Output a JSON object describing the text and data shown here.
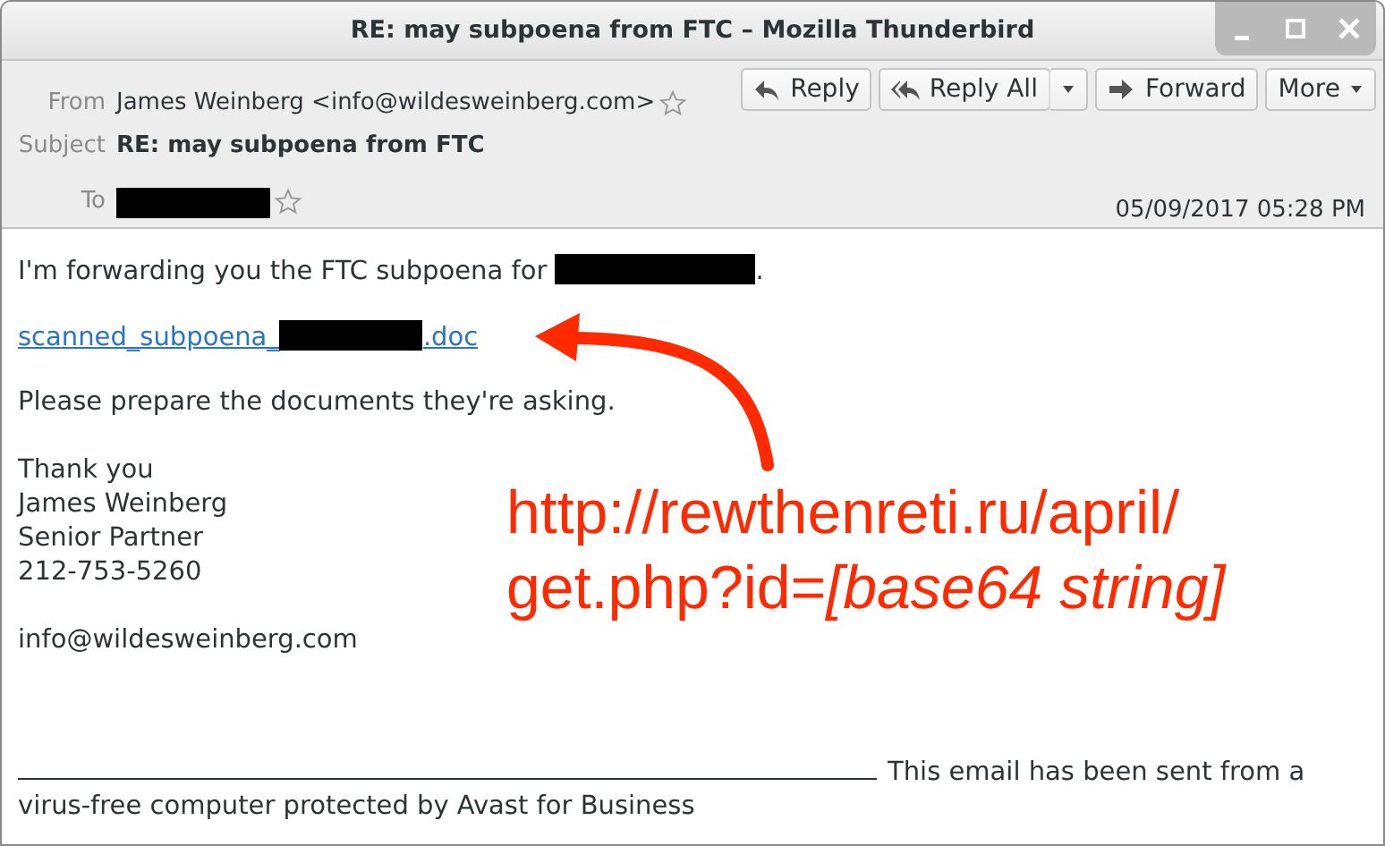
{
  "window": {
    "title": "RE: may subpoena from FTC – Mozilla Thunderbird"
  },
  "toolbar": {
    "buttons": [
      {
        "label": "Reply",
        "kind": "reply"
      },
      {
        "label": "Reply All",
        "kind": "reply-all"
      },
      {
        "label": "Forward",
        "kind": "forward"
      },
      {
        "label": "More",
        "kind": "more"
      }
    ]
  },
  "header": {
    "fields": [
      {
        "label": "From",
        "kind": "contact",
        "value": "James Weinberg <info@wildesweinberg.com>",
        "starred": false
      },
      {
        "label": "Subject",
        "kind": "subject",
        "value": "RE: may subpoena from FTC"
      },
      {
        "label": "To",
        "kind": "redacted",
        "starred": false
      }
    ],
    "date": "05/09/2017 05:28 PM"
  },
  "body": {
    "intro": {
      "text": "I'm forwarding you the FTC subpoena for",
      "after": "."
    },
    "attachment_link": {
      "prefix": "scanned_subpoena_",
      "suffix": ".doc"
    },
    "request": "Please prepare the documents they're asking.",
    "signature": [
      "Thank you",
      "James Weinberg",
      "Senior Partner",
      "212-753-5260"
    ],
    "email": "info@wildesweinberg.com",
    "footer": "This email has been sent from a virus-free computer protected by Avast for Business"
  },
  "annotation": {
    "lines": [
      "http://rewthenreti.ru/april/",
      "get.php?id=*[base64 string]*"
    ]
  }
}
